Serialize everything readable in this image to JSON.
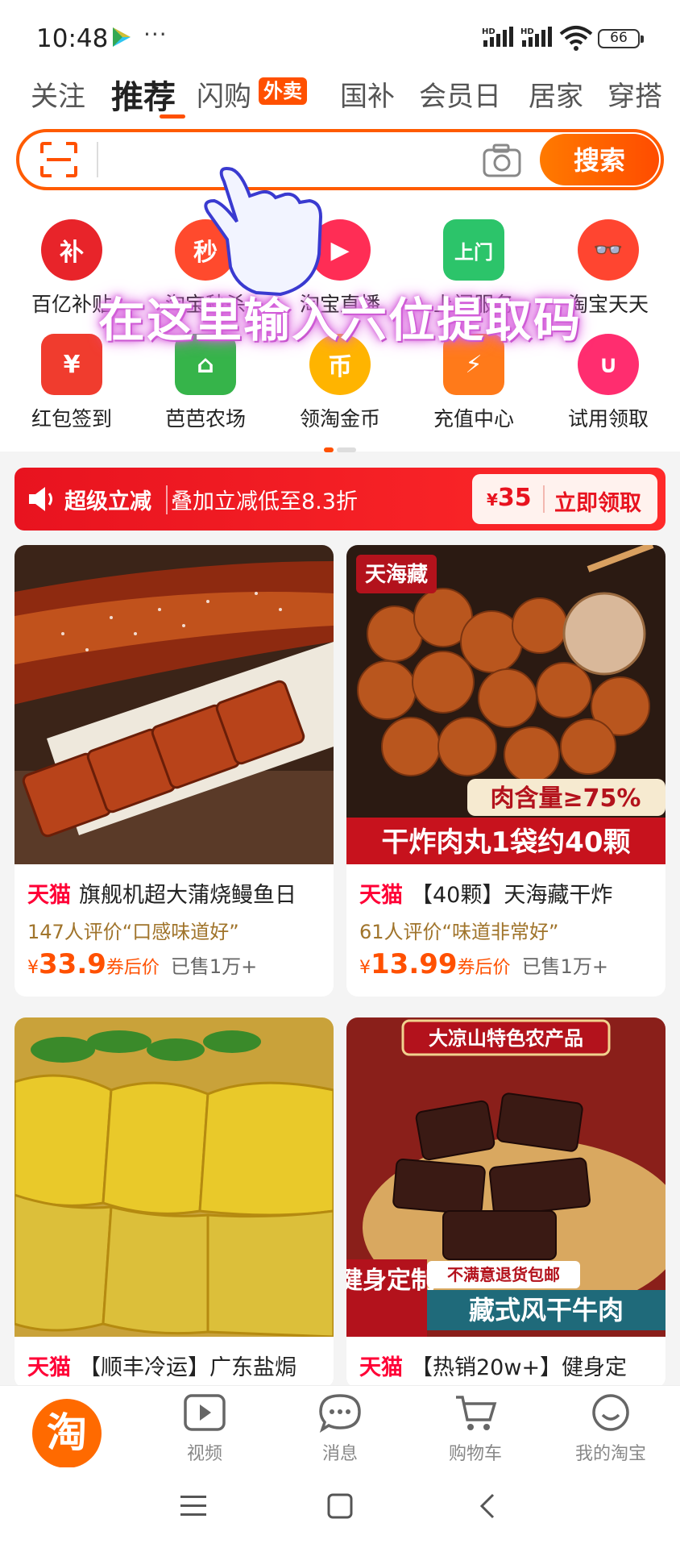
{
  "status_bar": {
    "time": "10:48",
    "dots": "···",
    "signal1": "HD",
    "signal2": "HD",
    "battery": "66"
  },
  "tabs": [
    {
      "label": "关注"
    },
    {
      "label": "推荐"
    },
    {
      "label": "闪购"
    },
    {
      "label": "国补"
    },
    {
      "label": "会员日"
    },
    {
      "label": "居家"
    },
    {
      "label": "穿搭"
    }
  ],
  "tab_badge": "外卖",
  "search": {
    "button_label": "搜索"
  },
  "grid_row1": [
    {
      "icon": "补",
      "label": "百亿补贴",
      "color": "#e8242a"
    },
    {
      "icon": "秒",
      "label": "淘宝秒杀",
      "color": "#ff4a2d"
    },
    {
      "icon": "▶",
      "label": "淘宝直播",
      "color": "#ff2d55"
    },
    {
      "icon": "上门",
      "label": "上门服务",
      "color": "#2cc46a"
    },
    {
      "icon": "👓",
      "label": "淘宝天天",
      "color": "#ff4530"
    }
  ],
  "grid_row2": [
    {
      "icon": "¥",
      "label": "红包签到",
      "color": "#f03c2e"
    },
    {
      "icon": "⌂",
      "label": "芭芭农场",
      "color": "#36b44a"
    },
    {
      "icon": "币",
      "label": "领淘金币",
      "color": "#ffb400"
    },
    {
      "icon": "⚡",
      "label": "充值中心",
      "color": "#ff7a1a"
    },
    {
      "icon": "∪",
      "label": "试用领取",
      "color": "#ff2d6f"
    }
  ],
  "overlay_text": "在这里输入六位提取码",
  "promo": {
    "title": "超级立减",
    "subtitle": "叠加立减低至8.3折",
    "currency": "¥",
    "amount": "35",
    "claim": "立即领取"
  },
  "products": [
    {
      "brand": "天猫",
      "title": "旗舰机超大蒲烧鳗鱼日",
      "review": "147人评价“口感味道好”",
      "currency": "¥",
      "price": "33.9",
      "price_note": "券后价",
      "sold": "已售1万+"
    },
    {
      "brand": "天猫",
      "title": "【40颗】天海藏干炸",
      "review": "61人评价“味道非常好”",
      "currency": "¥",
      "price": "13.99",
      "price_note": "券后价",
      "sold": "已售1万+",
      "img_logo": "天海藏",
      "img_badge": "肉含量≥75%",
      "img_caption": "干炸肉丸1袋约40颗"
    },
    {
      "brand": "天猫",
      "title": "【顺丰冷运】广东盐焗"
    },
    {
      "brand": "天猫",
      "title": "【热销20w+】健身定",
      "img_top": "大凉山特色农产品",
      "img_side": "健身定制",
      "img_tag": "不满意退货包邮",
      "img_caption": "藏式风干牛肉"
    }
  ],
  "bottom_nav": [
    {
      "label": "淘",
      "icon": "taobao-home-icon"
    },
    {
      "label": "视频",
      "icon": "video-icon"
    },
    {
      "label": "消息",
      "icon": "message-icon"
    },
    {
      "label": "购物车",
      "icon": "cart-icon"
    },
    {
      "label": "我的淘宝",
      "icon": "profile-icon"
    }
  ]
}
